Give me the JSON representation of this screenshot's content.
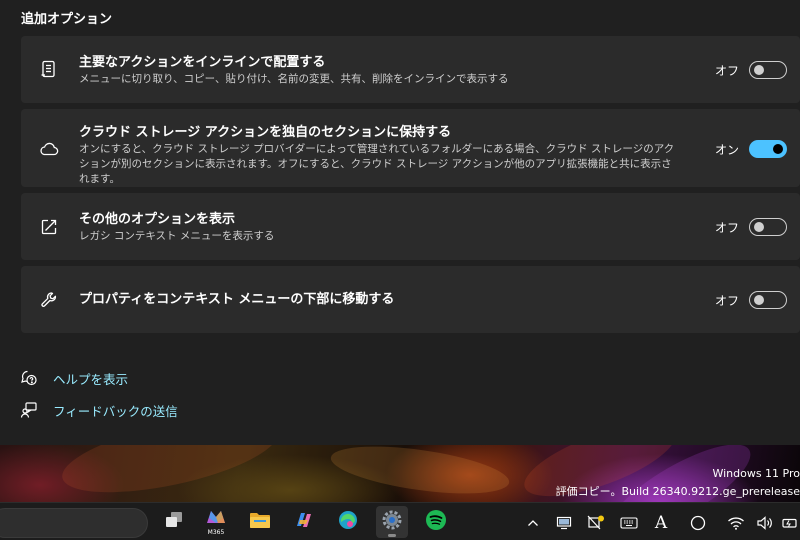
{
  "section": {
    "title": "追加オプション"
  },
  "options": [
    {
      "icon": "list-inline-icon",
      "title": "主要なアクションをインラインで配置する",
      "description": "メニューに切り取り、コピー、貼り付け、名前の変更、共有、削除をインラインで表示する",
      "state_label": "オフ",
      "on": false
    },
    {
      "icon": "cloud-icon",
      "title": "クラウド ストレージ アクションを独自のセクションに保持する",
      "description": "オンにすると、クラウド ストレージ プロバイダーによって管理されているフォルダーにある場合、クラウド ストレージのアクションが別のセクションに表示されます。オフにすると、クラウド ストレージ アクションが他のアプリ拡張機能と共に表示されます。",
      "state_label": "オン",
      "on": true
    },
    {
      "icon": "open-external-icon",
      "title": "その他のオプションを表示",
      "description": "レガシ コンテキスト メニューを表示する",
      "state_label": "オフ",
      "on": false
    },
    {
      "icon": "wrench-icon",
      "title": "プロパティをコンテキスト メニューの下部に移動する",
      "description": "",
      "state_label": "オフ",
      "on": false
    }
  ],
  "links": {
    "help": "ヘルプを表示",
    "feedback": "フィードバックの送信"
  },
  "watermark": {
    "line1": "Windows 11 Pro",
    "line2": "評価コピー。Build 26340.9212.ge_prerelease"
  },
  "taskbar": {
    "m365_label": "M365",
    "tray_ime_label": "A"
  },
  "colors": {
    "accent": "#4cc2ff",
    "link": "#99ebff",
    "card": "#2b2b2b",
    "background": "#202020",
    "spotify": "#1db954"
  }
}
